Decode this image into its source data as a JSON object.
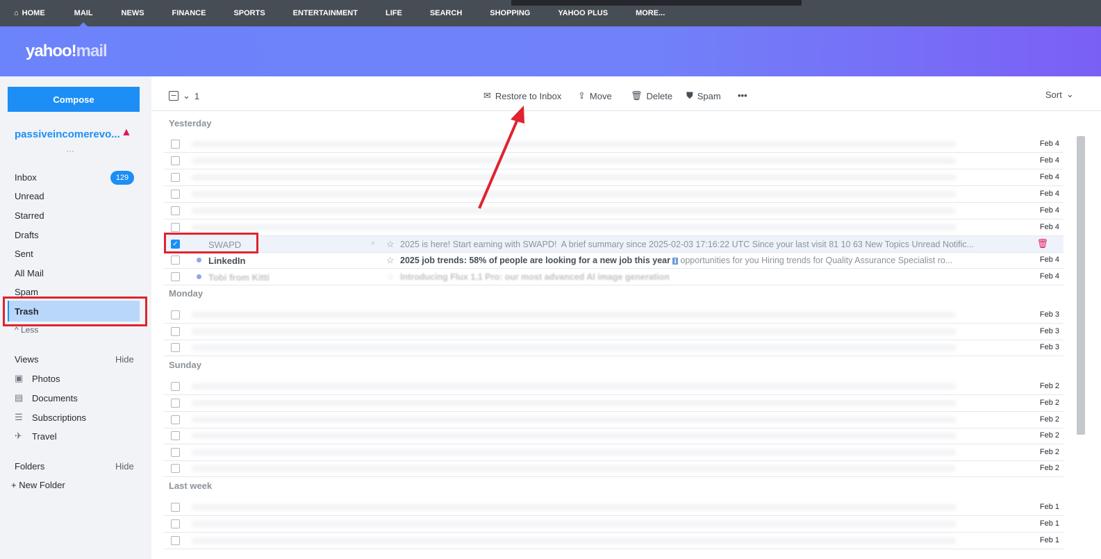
{
  "topnav": {
    "items": [
      "HOME",
      "MAIL",
      "NEWS",
      "FINANCE",
      "SPORTS",
      "ENTERTAINMENT",
      "LIFE",
      "SEARCH",
      "SHOPPING",
      "YAHOO PLUS",
      "MORE..."
    ],
    "active": "MAIL"
  },
  "logo": {
    "yahoo": "yahoo!",
    "mail": "mail"
  },
  "sidebar": {
    "compose": "Compose",
    "account": "passiveincomerevo...",
    "folders": [
      {
        "label": "Inbox",
        "count": "129"
      },
      {
        "label": "Unread"
      },
      {
        "label": "Starred"
      },
      {
        "label": "Drafts"
      },
      {
        "label": "Sent"
      },
      {
        "label": "All Mail"
      },
      {
        "label": "Spam"
      },
      {
        "label": "Trash"
      }
    ],
    "less": "Less",
    "views_label": "Views",
    "views_hide": "Hide",
    "views": [
      {
        "label": "Photos",
        "icon": "photo-icon"
      },
      {
        "label": "Documents",
        "icon": "document-icon"
      },
      {
        "label": "Subscriptions",
        "icon": "subscriptions-icon"
      },
      {
        "label": "Travel",
        "icon": "plane-icon"
      }
    ],
    "folders_label": "Folders",
    "folders_hide": "Hide",
    "new_folder": "New Folder"
  },
  "toolbar": {
    "selected_count": "1",
    "restore": "Restore to Inbox",
    "move": "Move",
    "delete": "Delete",
    "spam": "Spam",
    "sort": "Sort"
  },
  "groups": {
    "yesterday": "Yesterday",
    "monday": "Monday",
    "sunday": "Sunday",
    "last_week": "Last week"
  },
  "messages": {
    "swapd": {
      "sender": "SWAPD",
      "subject": "2025 is here! Start earning with SWAPD!",
      "preview": "A brief summary since 2025-02-03 17:16:22 UTC Since your last visit 81 10 63 New Topics Unread Notific..."
    },
    "linkedin": {
      "sender": "LinkedIn",
      "subject": "2025 job trends: 58% of people are looking for a new job this year",
      "preview": "opportunities for you Hiring trends for Quality Assurance Specialist ro...",
      "date": "Feb 4"
    },
    "tobi": {
      "sender": "Tobi from Kitti",
      "subject": "Introducing Flux 1.1 Pro: our most advanced AI image generation",
      "date": "Feb 4"
    }
  },
  "dates": {
    "feb4": "Feb 4",
    "feb3": "Feb 3",
    "feb2": "Feb 2",
    "feb1": "Feb 1"
  },
  "colors": {
    "accent": "#1d8ef5",
    "annotation": "#e0232e",
    "nav_bg": "#474d54"
  }
}
